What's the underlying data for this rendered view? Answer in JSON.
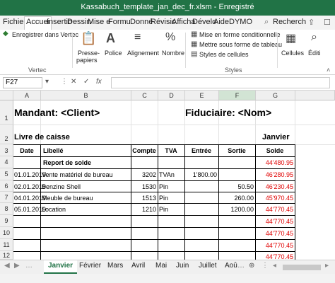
{
  "window": {
    "title": "Kassabuch_template_jan_dec_fr.xlsm - Enregistré",
    "accent": "#217346"
  },
  "ribbon_tabs": [
    "Fichier",
    "Accuei",
    "Insertio",
    "Dessin",
    "Mise e",
    "Formu",
    "Donné",
    "Révisic",
    "Afficha",
    "Dévelo",
    "Aide",
    "DYMO",
    "Recherch"
  ],
  "ribbon": {
    "save_vertec": "Enregistrer dans Vertec",
    "group_vertec": "Vertec",
    "paste_line1": "Presse-",
    "paste_line2": "papiers",
    "font": "Police",
    "alignment": "Alignement",
    "number": "Nombre",
    "cond_format": "Mise en forme conditionnelle",
    "table_format": "Mettre sous forme de tableau",
    "cell_styles": "Styles de cellules",
    "group_styles": "Styles",
    "cells": "Cellules",
    "edit": "Éditi"
  },
  "formula_bar": {
    "name_box": "F27",
    "fx_label": "fx",
    "value": ""
  },
  "columns": [
    "A",
    "B",
    "C",
    "D",
    "E",
    "F",
    "G"
  ],
  "rows": [
    "1",
    "2",
    "3",
    "4",
    "5",
    "6",
    "7",
    "8",
    "9",
    "10",
    "11",
    "12"
  ],
  "sheet": {
    "mandant": "Mandant: <Client>",
    "fiduciaire": "Fiduciaire: <Nom>",
    "livre": "Livre de caisse",
    "month": "Janvier",
    "headers": {
      "date": "Date",
      "libelle": "Libellé",
      "compte": "Compte",
      "tva": "TVA",
      "entree": "Entrée",
      "sortie": "Sortie",
      "solde": "Solde"
    },
    "report_label": "Report de solde",
    "report_solde": "44'480.95",
    "entries": [
      {
        "date": "01.01.2019",
        "libelle": "Vente matériel de bureau",
        "compte": "3202",
        "tva": "TVAn",
        "entree": "1'800.00",
        "sortie": "",
        "solde": "46'280.95"
      },
      {
        "date": "02.01.2019",
        "libelle": "Benzine Shell",
        "compte": "1530",
        "tva": "Pin",
        "entree": "",
        "sortie": "50.50",
        "solde": "46'230.45"
      },
      {
        "date": "04.01.2019",
        "libelle": "Meuble de bureau",
        "compte": "1513",
        "tva": "Pin",
        "entree": "",
        "sortie": "260.00",
        "solde": "45'970.45"
      },
      {
        "date": "05.01.2019",
        "libelle": "Location",
        "compte": "1210",
        "tva": "Pin",
        "entree": "",
        "sortie": "1200.00",
        "solde": "44'770.45"
      },
      {
        "date": "",
        "libelle": "",
        "compte": "",
        "tva": "",
        "entree": "",
        "sortie": "",
        "solde": "44'770.45"
      },
      {
        "date": "",
        "libelle": "",
        "compte": "",
        "tva": "",
        "entree": "",
        "sortie": "",
        "solde": "44'770.45"
      },
      {
        "date": "",
        "libelle": "",
        "compte": "",
        "tva": "",
        "entree": "",
        "sortie": "",
        "solde": "44'770.45"
      },
      {
        "date": "",
        "libelle": "",
        "compte": "",
        "tva": "",
        "entree": "",
        "sortie": "",
        "solde": "44'770.45"
      }
    ],
    "negative_color": "#e00000"
  },
  "sheet_tabs": [
    "Janvier",
    "Février",
    "Mars",
    "Avril",
    "Mai",
    "Juin",
    "Juillet",
    "Aoû"
  ],
  "active_sheet_tab": "Janvier"
}
